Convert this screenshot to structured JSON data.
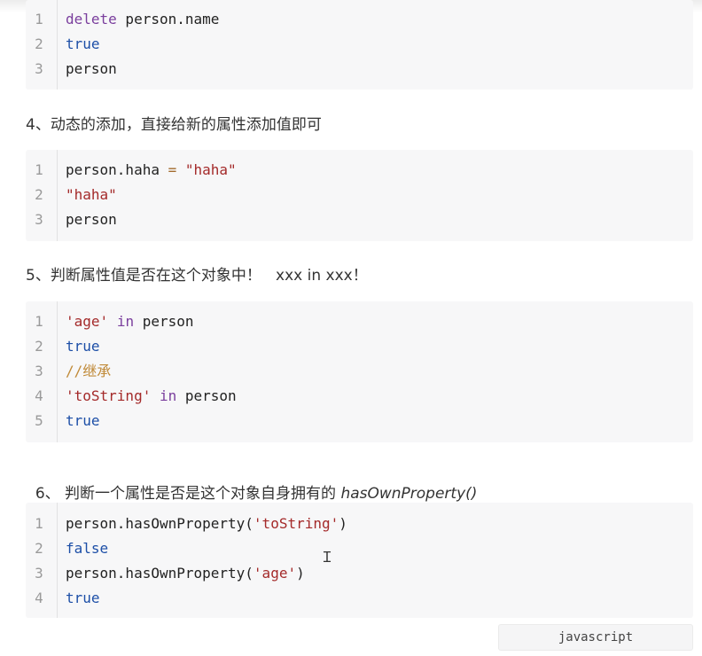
{
  "blocks": [
    {
      "lines": [
        {
          "n": "1",
          "parts": [
            {
              "t": "delete",
              "c": "kw"
            },
            {
              "t": " person.name",
              "c": ""
            }
          ]
        },
        {
          "n": "2",
          "parts": [
            {
              "t": "true",
              "c": "lit"
            }
          ]
        },
        {
          "n": "3",
          "parts": [
            {
              "t": "person",
              "c": ""
            }
          ]
        }
      ]
    },
    {
      "heading": "4、动态的添加，直接给新的属性添加值即可",
      "lines": [
        {
          "n": "1",
          "parts": [
            {
              "t": "person.haha ",
              "c": ""
            },
            {
              "t": "=",
              "c": "op"
            },
            {
              "t": " ",
              "c": ""
            },
            {
              "t": "\"haha\"",
              "c": "str"
            }
          ]
        },
        {
          "n": "2",
          "parts": [
            {
              "t": "\"haha\"",
              "c": "str"
            }
          ]
        },
        {
          "n": "3",
          "parts": [
            {
              "t": "person",
              "c": ""
            }
          ]
        }
      ]
    },
    {
      "heading": "5、判断属性值是否在这个对象中！   xxx in xxx！",
      "lines": [
        {
          "n": "1",
          "parts": [
            {
              "t": "'age'",
              "c": "str"
            },
            {
              "t": " ",
              "c": ""
            },
            {
              "t": "in",
              "c": "kw"
            },
            {
              "t": " person",
              "c": ""
            }
          ]
        },
        {
          "n": "2",
          "parts": [
            {
              "t": "true",
              "c": "lit"
            }
          ]
        },
        {
          "n": "3",
          "parts": [
            {
              "t": "//继承",
              "c": "cm"
            }
          ]
        },
        {
          "n": "4",
          "parts": [
            {
              "t": "'toString'",
              "c": "str"
            },
            {
              "t": " ",
              "c": ""
            },
            {
              "t": "in",
              "c": "kw"
            },
            {
              "t": " person",
              "c": ""
            }
          ]
        },
        {
          "n": "5",
          "parts": [
            {
              "t": "true",
              "c": "lit"
            }
          ]
        }
      ]
    },
    {
      "heading": "6、 判断一个属性是否是这个对象自身拥有的 ",
      "heading_italic": "hasOwnProperty()",
      "lines": [
        {
          "n": "1",
          "parts": [
            {
              "t": "person.hasOwnProperty(",
              "c": ""
            },
            {
              "t": "'toString'",
              "c": "str"
            },
            {
              "t": ")",
              "c": ""
            }
          ]
        },
        {
          "n": "2",
          "parts": [
            {
              "t": "false",
              "c": "lit"
            }
          ]
        },
        {
          "n": "3",
          "parts": [
            {
              "t": "person.hasOwnProperty(",
              "c": ""
            },
            {
              "t": "'age'",
              "c": "str"
            },
            {
              "t": ")",
              "c": ""
            }
          ]
        },
        {
          "n": "4",
          "parts": [
            {
              "t": "true",
              "c": "lit"
            }
          ]
        }
      ]
    }
  ],
  "language_label": "javascript"
}
